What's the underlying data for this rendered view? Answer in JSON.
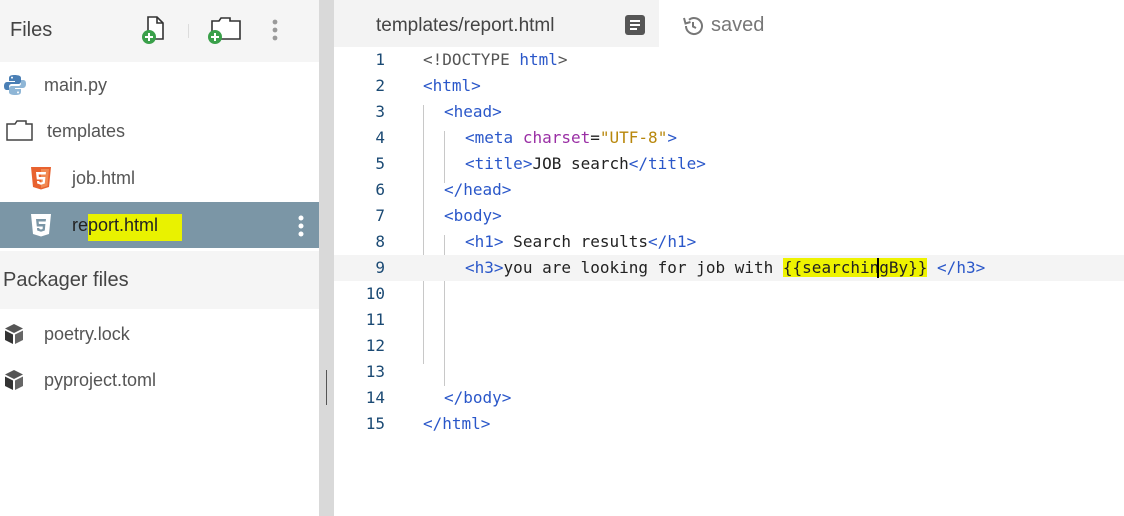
{
  "sidebar": {
    "title": "Files",
    "header_icons": [
      "add-file-icon",
      "add-folder-icon",
      "more-vert-icon"
    ],
    "items": [
      {
        "label": "main.py",
        "icon": "python-icon"
      },
      {
        "label": "templates",
        "icon": "folder-icon"
      },
      {
        "label": "job.html",
        "icon": "html5-icon"
      },
      {
        "label_plain": "re",
        "label_highlight": "port.html",
        "icon": "html5-icon",
        "selected": true
      }
    ],
    "packager": {
      "title": "Packager files",
      "items": [
        {
          "label": "poetry.lock",
          "icon": "package-icon"
        },
        {
          "label": "pyproject.toml",
          "icon": "package-icon"
        }
      ]
    }
  },
  "editor": {
    "tab_label": "templates/report.html",
    "status": "saved",
    "active_line": 9,
    "highlight_color": "#eef300",
    "lines": [
      {
        "n": "1"
      },
      {
        "n": "2"
      },
      {
        "n": "3"
      },
      {
        "n": "4"
      },
      {
        "n": "5"
      },
      {
        "n": "6"
      },
      {
        "n": "7"
      },
      {
        "n": "8"
      },
      {
        "n": "9"
      },
      {
        "n": "10"
      },
      {
        "n": "11"
      },
      {
        "n": "12"
      },
      {
        "n": "13"
      },
      {
        "n": "14"
      },
      {
        "n": "15"
      }
    ],
    "code": {
      "l1": {
        "open": "<!DOCTYPE ",
        "name": "html",
        "close": ">"
      },
      "l2": {
        "open": "<",
        "name": "html",
        "close": ">"
      },
      "l3": {
        "open": "<",
        "name": "head",
        "close": ">"
      },
      "l4": {
        "open": "<",
        "name": "meta",
        "attr": "charset",
        "eq": "=",
        "val": "\"UTF-8\"",
        "close": ">"
      },
      "l5": {
        "open": "<",
        "name": "title",
        "close": ">",
        "text": "JOB search",
        "end_open": "</",
        "end_name": "title",
        "end_close": ">"
      },
      "l6": {
        "open": "</",
        "name": "head",
        "close": ">"
      },
      "l7": {
        "open": "<",
        "name": "body",
        "close": ">"
      },
      "l8": {
        "open": "<",
        "name": "h1",
        "close": ">",
        "text": " Search results",
        "end_open": "</",
        "end_name": "h1",
        "end_close": ">"
      },
      "l9": {
        "open": "<",
        "name": "h3",
        "close": ">",
        "text": "you are looking for job with ",
        "hl": "{{searchingBy}}",
        "after": " ",
        "end_open": "</",
        "end_name": "h3",
        "end_close": ">"
      },
      "l14": {
        "open": "</",
        "name": "body",
        "close": ">"
      },
      "l15": {
        "open": "</",
        "name": "html",
        "close": ">"
      }
    }
  }
}
